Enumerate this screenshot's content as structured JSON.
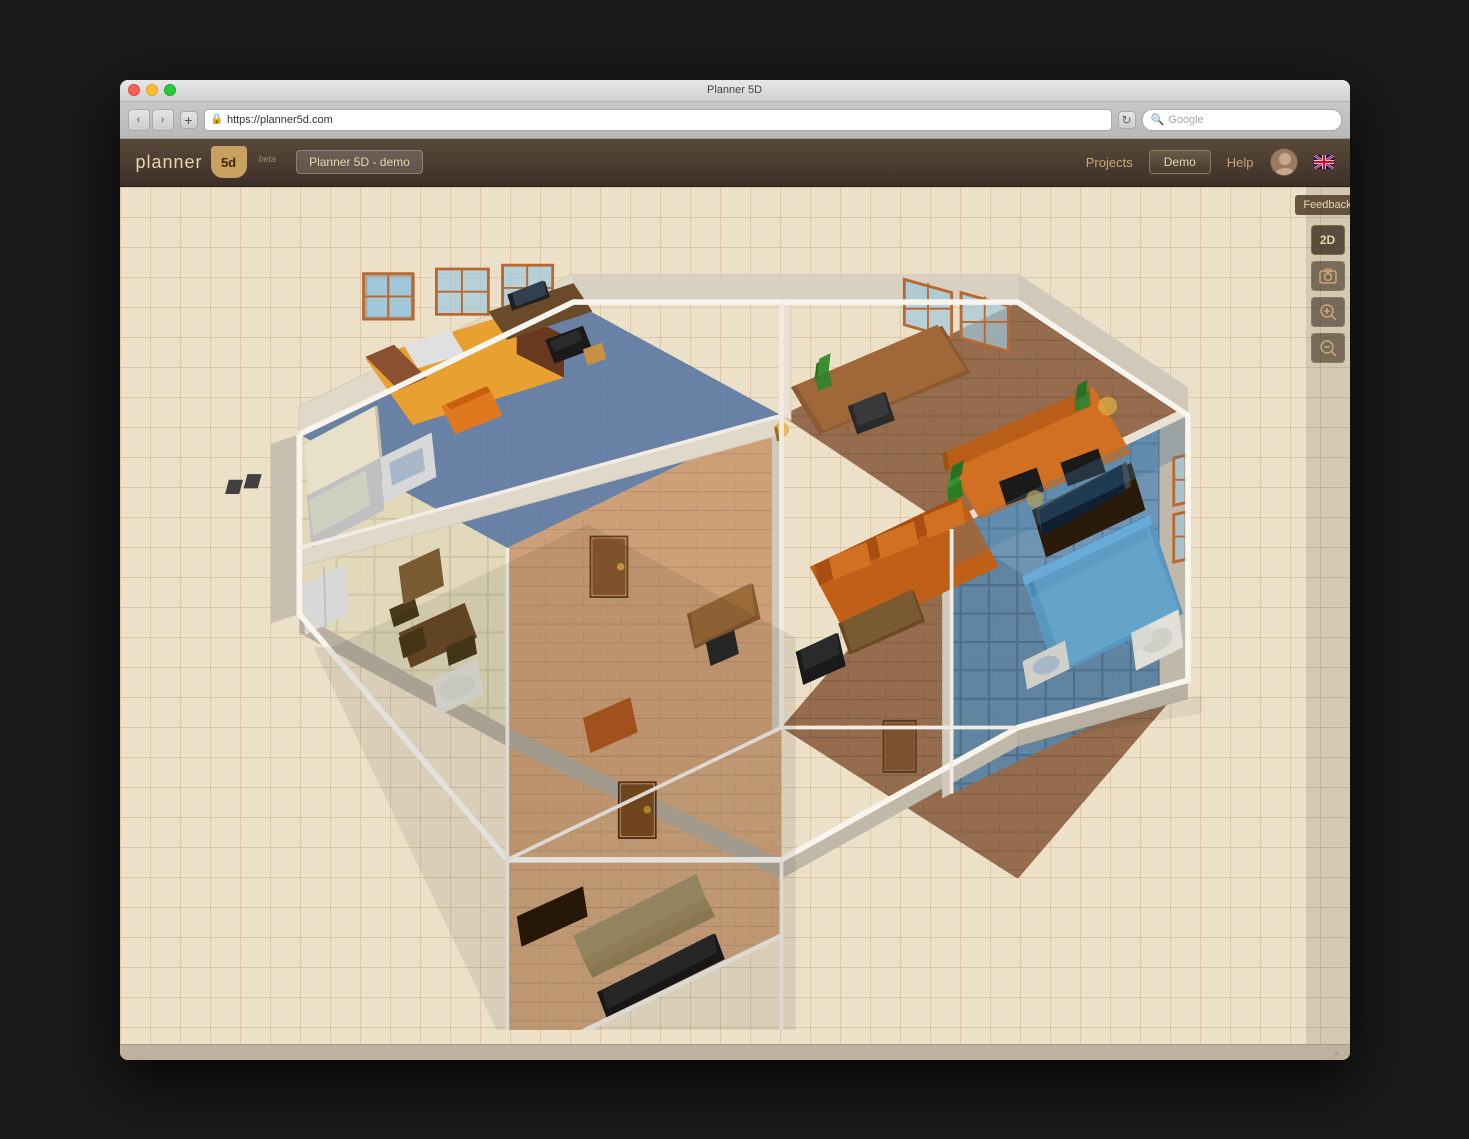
{
  "window": {
    "title": "Planner 5D",
    "url": "https://planner5d.com",
    "search_placeholder": "Google"
  },
  "app": {
    "logo_text": "planner",
    "logo_num": "5d",
    "beta_label": "beta",
    "project_name": "Planner 5D - demo",
    "nav": {
      "projects": "Projects",
      "demo": "Demo",
      "help": "Help"
    }
  },
  "toolbar": {
    "feedback_label": "Feedback",
    "view_2d": "2D",
    "zoom_in_icon": "+🔍",
    "zoom_out_icon": "🔍",
    "screenshot_icon": "📷"
  },
  "browser": {
    "back": "‹",
    "forward": "›",
    "add": "+",
    "reload": "↻"
  }
}
